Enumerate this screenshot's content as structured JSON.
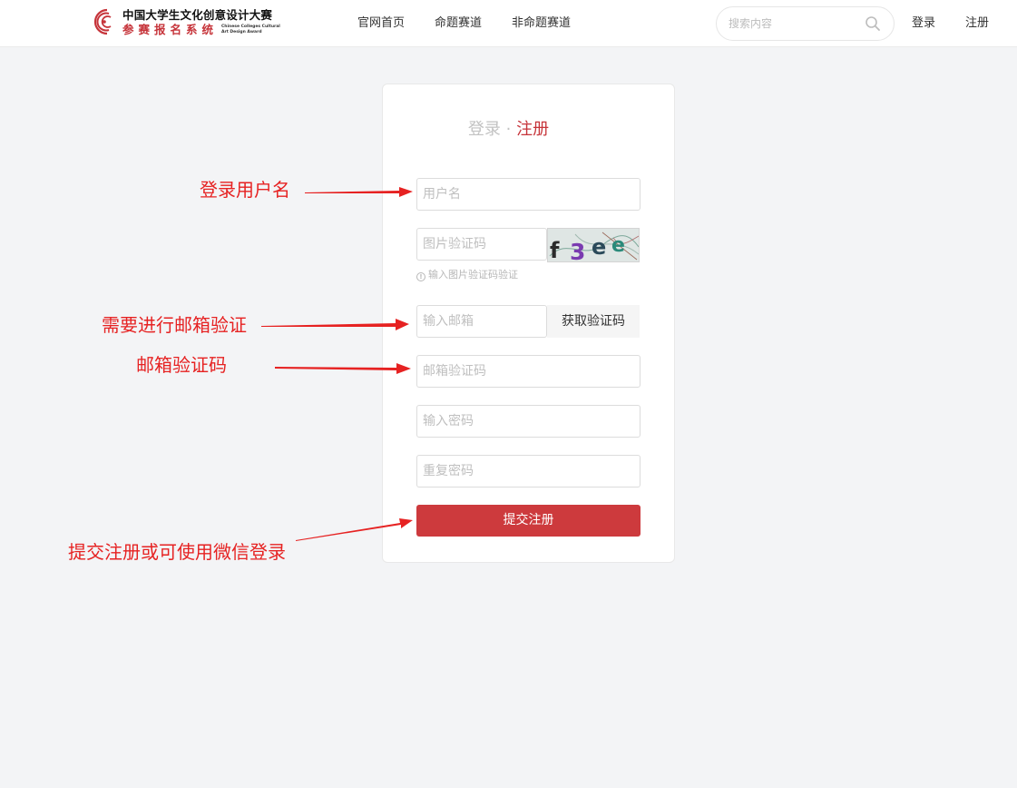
{
  "header": {
    "logo": {
      "title": "中国大学生文化创意设计大赛",
      "subtitle": "参赛报名系统",
      "english_line1": "Chinese Colleges Cultural",
      "english_line2": "Art Design Award"
    },
    "nav": [
      {
        "label": "官网首页"
      },
      {
        "label": "命题赛道"
      },
      {
        "label": "非命题赛道"
      }
    ],
    "search": {
      "placeholder": "搜索内容",
      "icon": "search-icon"
    },
    "login_link": "登录",
    "register_link": "注册"
  },
  "form": {
    "title_login": "登录",
    "title_separator": "·",
    "title_register": "注册",
    "username_placeholder": "用户名",
    "captcha_placeholder": "图片验证码",
    "captcha_text": "f3ee",
    "captcha_hint": "输入图片验证码验证",
    "email_placeholder": "输入邮箱",
    "get_code_label": "获取验证码",
    "email_code_placeholder": "邮箱验证码",
    "password_placeholder": "输入密码",
    "repeat_password_placeholder": "重复密码",
    "submit_label": "提交注册"
  },
  "annotations": [
    {
      "text": "登录用户名"
    },
    {
      "text": "需要进行邮箱验证"
    },
    {
      "text": "邮箱验证码"
    },
    {
      "text": "提交注册或可使用微信登录"
    }
  ],
  "colors": {
    "accent": "#cd3a3d",
    "annotation": "#e62222",
    "background": "#f3f4f6"
  }
}
